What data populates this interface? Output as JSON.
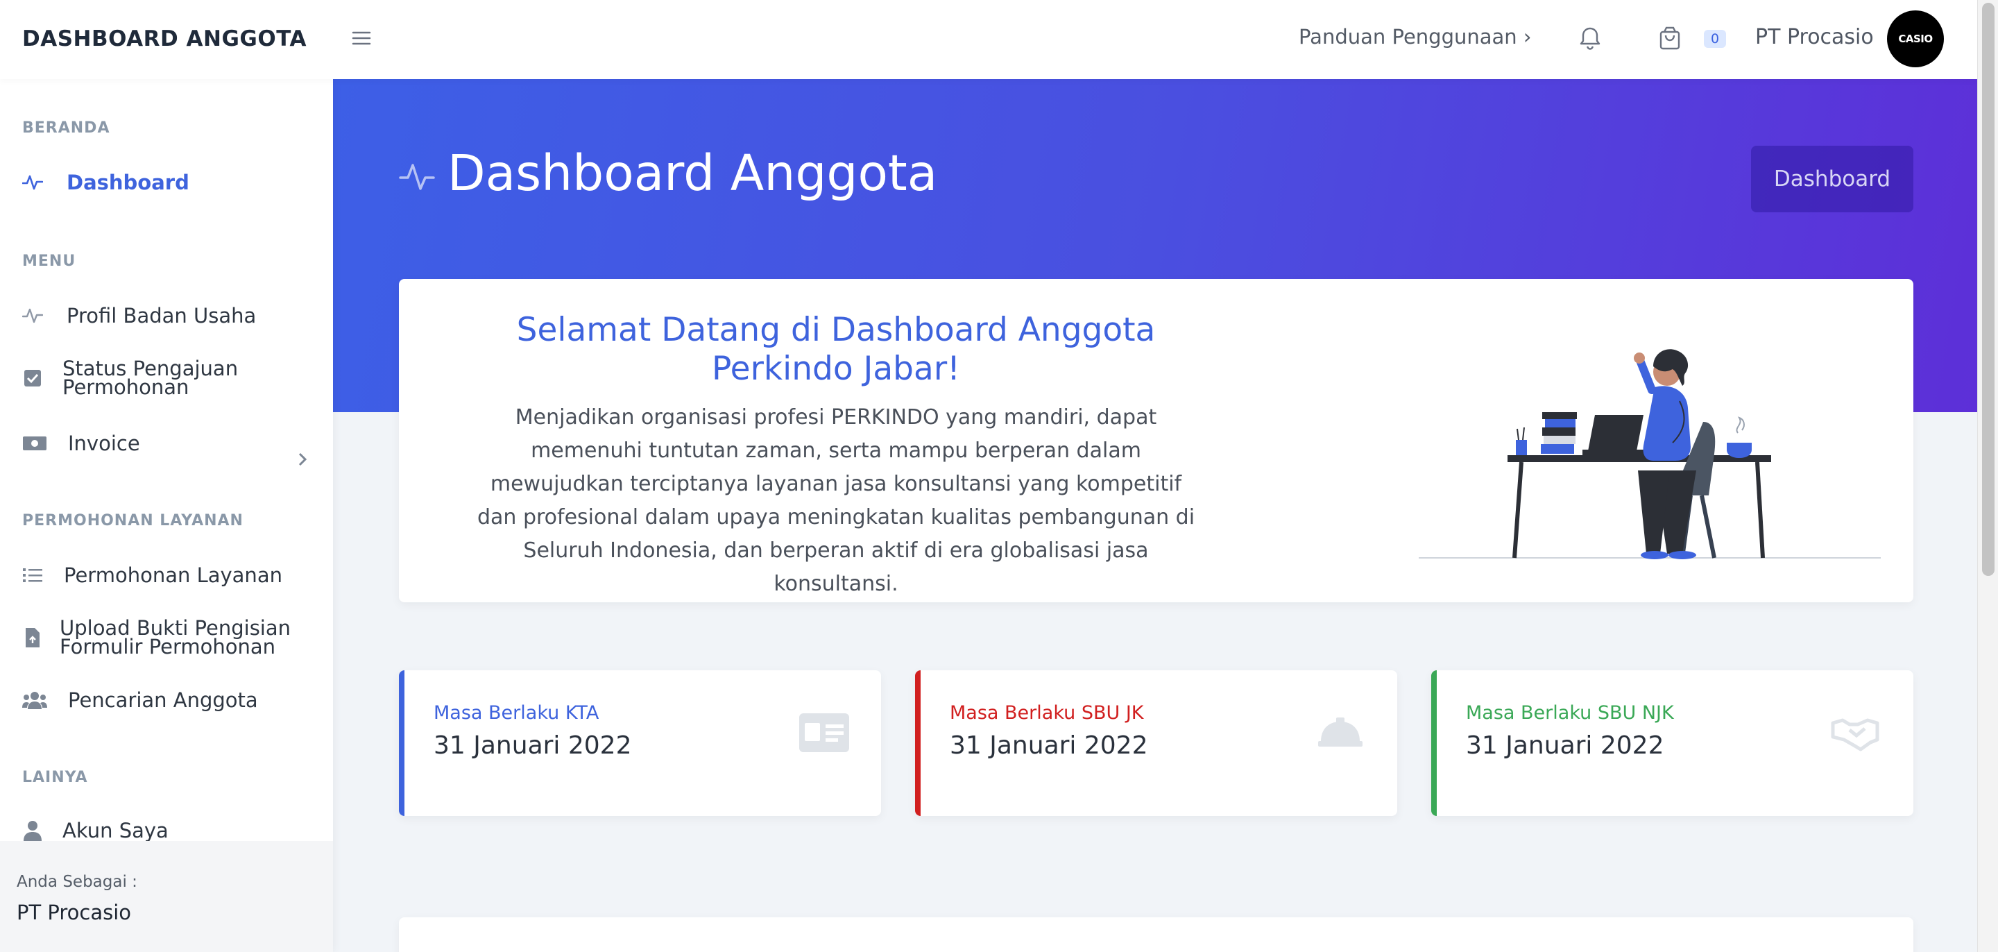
{
  "app": {
    "brand": "DASHBOARD ANGGOTA"
  },
  "topbar": {
    "guide_label": "Panduan Penggunaan",
    "guide_chevron": "›",
    "cart_count": "0",
    "user_name": "PT Procasio",
    "avatar_text": "CASIO"
  },
  "sidebar": {
    "sections": [
      {
        "title": "BERANDA"
      },
      {
        "title": "MENU"
      },
      {
        "title": "PERMOHONAN LAYANAN"
      },
      {
        "title": "LAINYA"
      }
    ],
    "items": [
      {
        "label": "Dashboard",
        "icon": "pulse-icon",
        "active": true
      },
      {
        "label": "Profil Badan Usaha",
        "icon": "pulse-icon"
      },
      {
        "label_line1": "Status Pengajuan",
        "label_line2": "Permohonan",
        "icon": "check-square-icon"
      },
      {
        "label": "Invoice",
        "icon": "money-bill-icon"
      },
      {
        "label": "Permohonan Layanan",
        "icon": "list-icon"
      },
      {
        "label_line1": "Upload Bukti Pengisian",
        "label_line2": "Formulir Permohonan",
        "icon": "file-upload-icon"
      },
      {
        "label": "Pencarian Anggota",
        "icon": "users-icon"
      },
      {
        "label": "Akun Saya",
        "icon": "user-icon"
      }
    ],
    "footer": {
      "label": "Anda Sebagai :",
      "value": "PT Procasio"
    }
  },
  "hero": {
    "title": "Dashboard Anggota",
    "button_label": "Dashboard"
  },
  "welcome": {
    "title": "Selamat Datang di Dashboard Anggota Perkindo Jabar!",
    "text": "Menjadikan organisasi profesi PERKINDO yang mandiri, dapat memenuhi tuntutan zaman, serta mampu berperan dalam mewujudkan terciptanya layanan jasa konsultansi yang kompetitif dan profesional dalam upaya meningkatan kualitas pembangunan di Seluruh Indonesia, dan berperan aktif di era globalisasi jasa konsultansi."
  },
  "stats": [
    {
      "label": "Masa Berlaku KTA",
      "value": "31 Januari 2022",
      "color": "#3e63dd",
      "icon": "id-card-icon"
    },
    {
      "label": "Masa Berlaku SBU JK",
      "value": "31 Januari 2022",
      "color": "#d11f1f",
      "icon": "hard-hat-icon"
    },
    {
      "label": "Masa Berlaku SBU NJK",
      "value": "31 Januari 2022",
      "color": "#3aa856",
      "icon": "handshake-icon"
    }
  ],
  "colors": {
    "accent": "#3e63dd",
    "hero_start": "#3d5fe6",
    "hero_end": "#5d2fd8"
  }
}
